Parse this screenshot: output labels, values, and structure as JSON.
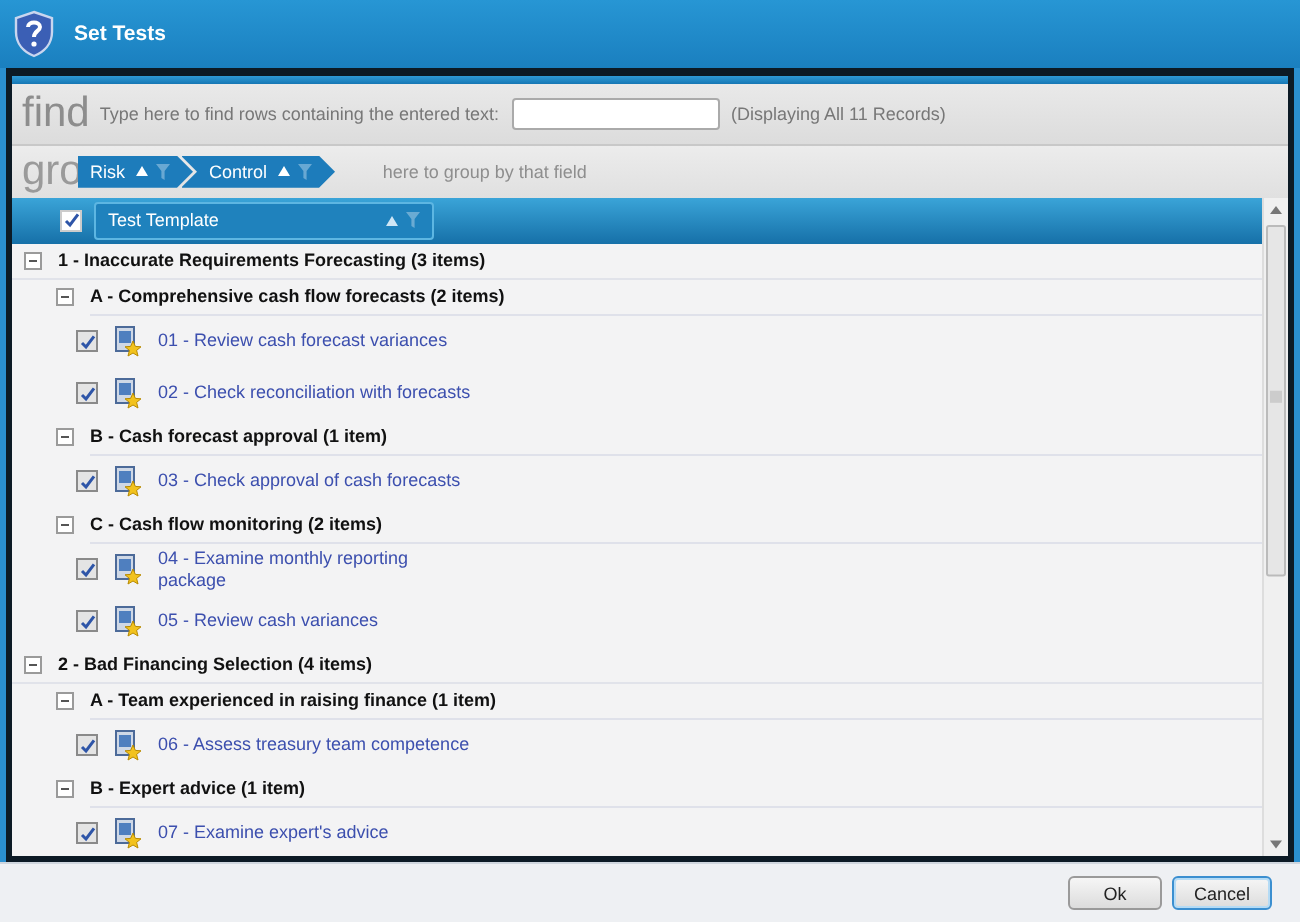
{
  "window": {
    "title": "Set Tests"
  },
  "find": {
    "label": "find",
    "prompt": "Type here to find rows containing the entered text:",
    "status": "(Displaying All 11 Records)"
  },
  "group_bar": {
    "watermark": "gro",
    "hint": "here to group by that field",
    "chips": [
      {
        "label": "Risk"
      },
      {
        "label": "Control"
      }
    ]
  },
  "header": {
    "checked": true,
    "column": "Test Template"
  },
  "groups": [
    {
      "label": "1 - Inaccurate Requirements Forecasting (3 items)",
      "expanded": true,
      "children": [
        {
          "label": "A - Comprehensive cash flow forecasts (2 items)",
          "expanded": true,
          "tests": [
            {
              "label": "01 - Review cash forecast variances",
              "checked": true
            },
            {
              "label": "02 - Check reconciliation with forecasts",
              "checked": true
            }
          ]
        },
        {
          "label": "B - Cash forecast approval (1 item)",
          "expanded": true,
          "tests": [
            {
              "label": "03 - Check approval of cash forecasts",
              "checked": true
            }
          ]
        },
        {
          "label": "C - Cash flow monitoring (2 items)",
          "expanded": true,
          "tests": [
            {
              "label": "04 - Examine monthly reporting\npackage",
              "checked": true
            },
            {
              "label": "05 - Review cash variances",
              "checked": true
            }
          ]
        }
      ]
    },
    {
      "label": "2 - Bad Financing Selection (4 items)",
      "expanded": true,
      "children": [
        {
          "label": "A - Team experienced in raising finance (1 item)",
          "expanded": true,
          "tests": [
            {
              "label": "06 - Assess treasury team competence",
              "checked": true
            }
          ]
        },
        {
          "label": "B - Expert advice (1 item)",
          "expanded": true,
          "tests": [
            {
              "label": "07 - Examine expert's advice",
              "checked": true
            }
          ]
        }
      ]
    }
  ],
  "buttons": [
    {
      "label": "Ok",
      "focused": false
    },
    {
      "label": "Cancel",
      "focused": true
    }
  ]
}
